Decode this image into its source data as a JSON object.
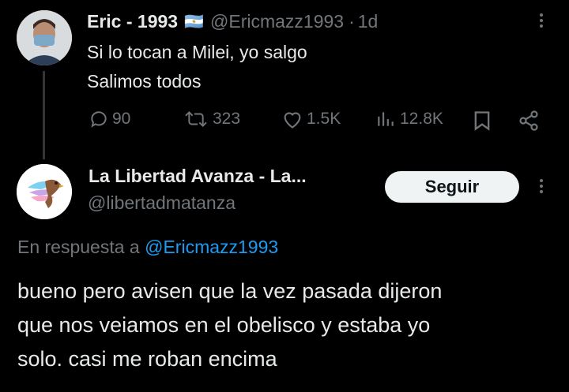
{
  "tweet": {
    "author_name": "Eric - 1993",
    "flag": "🇦🇷",
    "handle": "@Ericmazz1993",
    "separator": "·",
    "time": "1d",
    "line1": "Si lo tocan a Milei, yo salgo",
    "line2": "Salimos todos",
    "actions": {
      "replies": "90",
      "retweets": "323",
      "likes": "1.5K",
      "views": "12.8K"
    },
    "icons": [
      "reply-icon",
      "retweet-icon",
      "like-icon",
      "views-icon",
      "bookmark-icon",
      "share-icon",
      "more-icon"
    ]
  },
  "reply": {
    "author_name": "La Libertad Avanza - La...",
    "handle": "@libertadmatanza",
    "follow_label": "Seguir",
    "replying_to_prefix": "En respuesta a",
    "replying_to_handle": "@Ericmazz1993",
    "body_line1": "bueno pero avisen que la vez pasada dijeron",
    "body_line2": "que nos veiamos en el obelisco y estaba yo",
    "body_line3": "solo. casi me roban encima"
  },
  "colors": {
    "background": "#000000",
    "text": "#e7e9ea",
    "muted": "#71767b",
    "link": "#1d9bf0"
  }
}
